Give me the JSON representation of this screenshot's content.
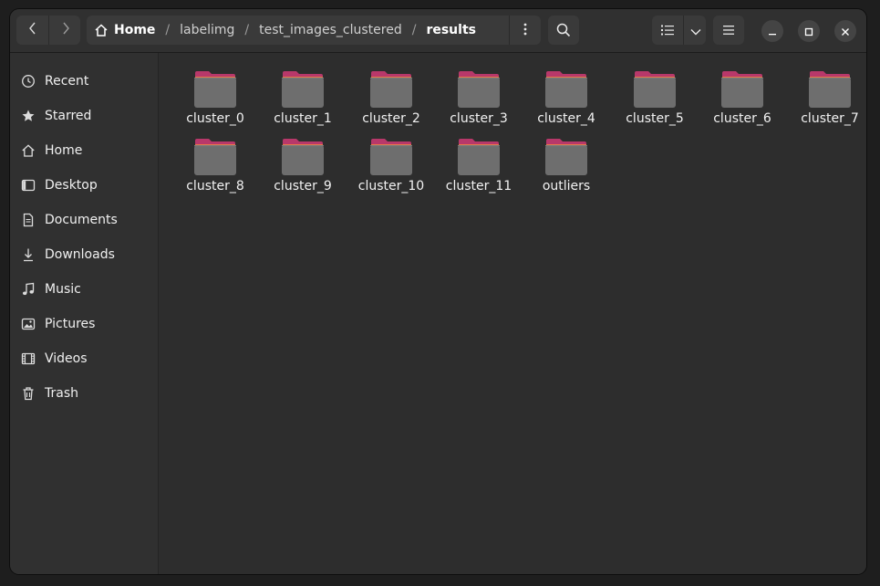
{
  "nav": {
    "back_icon": "chevron-left-icon",
    "forward_icon": "chevron-right-icon"
  },
  "path": {
    "home_label": "Home",
    "crumbs": [
      "labelimg",
      "test_images_clustered",
      "results"
    ],
    "menu_icon": "kebab-menu-icon"
  },
  "toolbar": {
    "search_icon": "search-icon",
    "view_icon": "list-view-icon",
    "view_dropdown_icon": "chevron-down-icon",
    "menu_icon": "hamburger-menu-icon"
  },
  "window_controls": [
    "minimize-icon",
    "maximize-icon",
    "close-icon"
  ],
  "sidebar": {
    "items": [
      {
        "label": "Recent",
        "icon": "clock-icon"
      },
      {
        "label": "Starred",
        "icon": "star-icon"
      },
      {
        "label": "Home",
        "icon": "home-icon"
      },
      {
        "label": "Desktop",
        "icon": "desktop-icon"
      },
      {
        "label": "Documents",
        "icon": "document-icon"
      },
      {
        "label": "Downloads",
        "icon": "download-icon"
      },
      {
        "label": "Music",
        "icon": "music-icon"
      },
      {
        "label": "Pictures",
        "icon": "picture-icon"
      },
      {
        "label": "Videos",
        "icon": "video-icon"
      },
      {
        "label": "Trash",
        "icon": "trash-icon"
      }
    ]
  },
  "files": {
    "items": [
      {
        "name": "cluster_0"
      },
      {
        "name": "cluster_1"
      },
      {
        "name": "cluster_2"
      },
      {
        "name": "cluster_3"
      },
      {
        "name": "cluster_4"
      },
      {
        "name": "cluster_5"
      },
      {
        "name": "cluster_6"
      },
      {
        "name": "cluster_7"
      },
      {
        "name": "cluster_8"
      },
      {
        "name": "cluster_9"
      },
      {
        "name": "cluster_10"
      },
      {
        "name": "cluster_11"
      },
      {
        "name": "outliers"
      }
    ]
  },
  "colors": {
    "folder_tab": "#b8386a",
    "folder_top": "#e8784a",
    "folder_body": "#6e6e6e",
    "window_bg": "#2d2d2d"
  }
}
